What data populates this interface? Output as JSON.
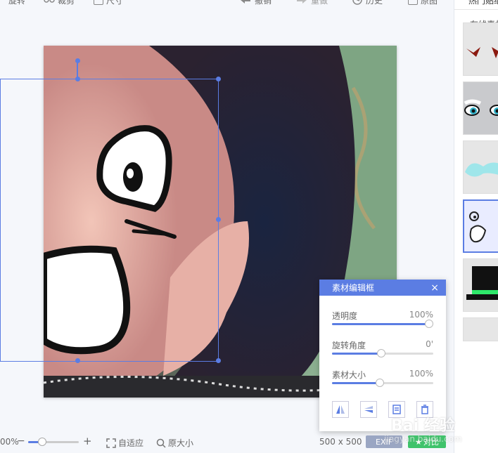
{
  "toolbar": {
    "rotate": "旋转",
    "crop": "裁剪",
    "size": "尺寸",
    "undo": "撤销",
    "redo": "重做",
    "history": "历史",
    "original": "原图"
  },
  "right_panel": {
    "tab": "热门贴纸",
    "online": "在线素材"
  },
  "dialog": {
    "title": "素材编辑框",
    "close": "×",
    "opacity": {
      "label": "透明度",
      "value": "100%",
      "level": 1.0
    },
    "rotation": {
      "label": "旋转角度",
      "value": "0'",
      "level": 0.5
    },
    "scale": {
      "label": "素材大小",
      "value": "100%",
      "level": 0.48
    }
  },
  "bottom": {
    "zoom": "00%",
    "minus": "−",
    "plus": "+",
    "fit": "自适应",
    "actual": "原大小",
    "size": "500 x 500",
    "exif": "EXIF",
    "compare": "对比"
  },
  "watermark": {
    "brand": "Bai  经验",
    "url": "jingyan.baidu.com"
  },
  "colors": {
    "accent": "#5b7de3",
    "compare_green": "#3fc36b",
    "exif_gray": "#9aa6c3"
  }
}
